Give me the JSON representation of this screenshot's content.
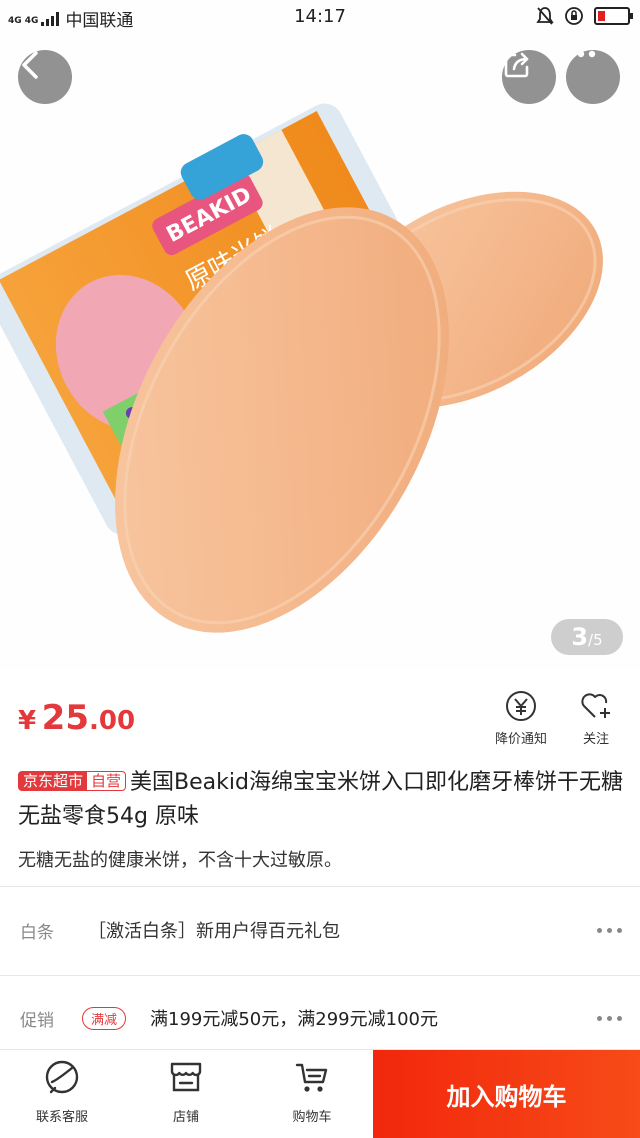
{
  "status_bar": {
    "network": "4G 4G",
    "carrier": "中国联通",
    "time": "14:17",
    "battery_level": 0.22
  },
  "gallery": {
    "current": "3",
    "total": "/5"
  },
  "price": {
    "currency": "¥",
    "integer": "25",
    "decimal": ".00"
  },
  "actions": {
    "price_alert": "降价通知",
    "follow": "关注"
  },
  "product": {
    "tag_supermarket": "京东超市",
    "tag_self": "自营",
    "title": "美国Beakid海绵宝宝米饼入口即化磨牙棒饼干无糖无盐零食54g 原味",
    "subtitle": "无糖无盐的健康米饼，不含十大过敏原。"
  },
  "baitiao": {
    "label": "白条",
    "text": "［激活白条］新用户得百元礼包"
  },
  "promotion": {
    "label": "促销",
    "badge": "满减",
    "text": "满199元减50元，满299元减100元"
  },
  "bottom_bar": {
    "service": "联系客服",
    "shop": "店铺",
    "cart": "购物车",
    "add_to_cart": "加入购物车"
  },
  "colors": {
    "accent": "#e4393c",
    "cta": "#f2270c"
  }
}
